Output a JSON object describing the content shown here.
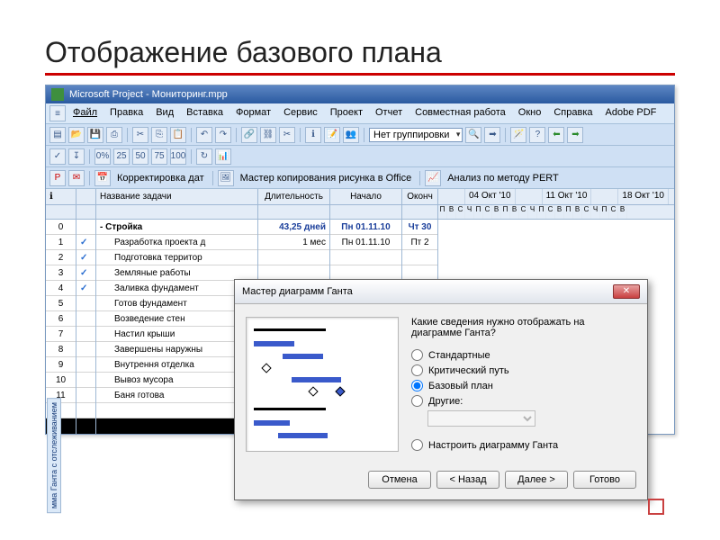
{
  "slide": {
    "title": "Отображение базового плана"
  },
  "app": {
    "title": "Microsoft Project - Мониторинг.mpp",
    "menus": [
      "Файл",
      "Правка",
      "Вид",
      "Вставка",
      "Формат",
      "Сервис",
      "Проект",
      "Отчет",
      "Совместная работа",
      "Окно",
      "Справка",
      "Adobe PDF"
    ],
    "grouping": "Нет группировки",
    "toolbar_labels": {
      "correction": "Корректировка дат",
      "copy_wizard": "Мастер копирования рисунка в Office",
      "pert": "Анализ по методу PERT"
    }
  },
  "columns": {
    "info": "",
    "task": "Название задачи",
    "duration": "Длительность",
    "start": "Начало",
    "finish": "Оконч"
  },
  "timeline_weeks": [
    "04 Окт '10",
    "11 Окт '10",
    "18 Окт '10"
  ],
  "timeline_days": [
    "П",
    "В",
    "С",
    "Ч",
    "П",
    "С",
    "В"
  ],
  "tasks": [
    {
      "id": "0",
      "name": "- Стройка",
      "duration": "43,25 дней",
      "start": "Пн 01.11.10",
      "finish": "Чт 30",
      "check": false,
      "bold": true
    },
    {
      "id": "1",
      "name": "Разработка проекта д",
      "duration": "1 мес",
      "start": "Пн 01.11.10",
      "finish": "Пт 2",
      "check": true
    },
    {
      "id": "2",
      "name": "Подготовка территор",
      "duration": "",
      "start": "",
      "finish": "",
      "check": true
    },
    {
      "id": "3",
      "name": "Земляные работы",
      "duration": "",
      "start": "",
      "finish": "",
      "check": true
    },
    {
      "id": "4",
      "name": "Заливка фундамент",
      "duration": "",
      "start": "",
      "finish": "",
      "check": true
    },
    {
      "id": "5",
      "name": "Готов фундамент",
      "duration": "",
      "start": "",
      "finish": "",
      "check": false
    },
    {
      "id": "6",
      "name": "Возведение стен",
      "duration": "",
      "start": "",
      "finish": "",
      "check": false
    },
    {
      "id": "7",
      "name": "Настил крыши",
      "duration": "",
      "start": "",
      "finish": "",
      "check": false
    },
    {
      "id": "8",
      "name": "Завершены наружны",
      "duration": "",
      "start": "",
      "finish": "",
      "check": false
    },
    {
      "id": "9",
      "name": "Внутрення отделка",
      "duration": "",
      "start": "",
      "finish": "",
      "check": false
    },
    {
      "id": "10",
      "name": "Вывоз мусора",
      "duration": "",
      "start": "",
      "finish": "",
      "check": false
    },
    {
      "id": "11",
      "name": "Баня готова",
      "duration": "",
      "start": "",
      "finish": "",
      "check": false
    }
  ],
  "vtab": "мма Ганта с отслеживанием",
  "dialog": {
    "title": "Мастер диаграмм Ганта",
    "question": "Какие сведения нужно отображать на диаграмме Ганта?",
    "options": {
      "standard": "Стандартные",
      "critical": "Критический путь",
      "baseline": "Базовый план",
      "other": "Другие:",
      "custom": "Настроить диаграмму Ганта"
    },
    "selected": "baseline",
    "buttons": {
      "cancel": "Отмена",
      "back": "< Назад",
      "next": "Далее >",
      "finish": "Готово"
    }
  }
}
